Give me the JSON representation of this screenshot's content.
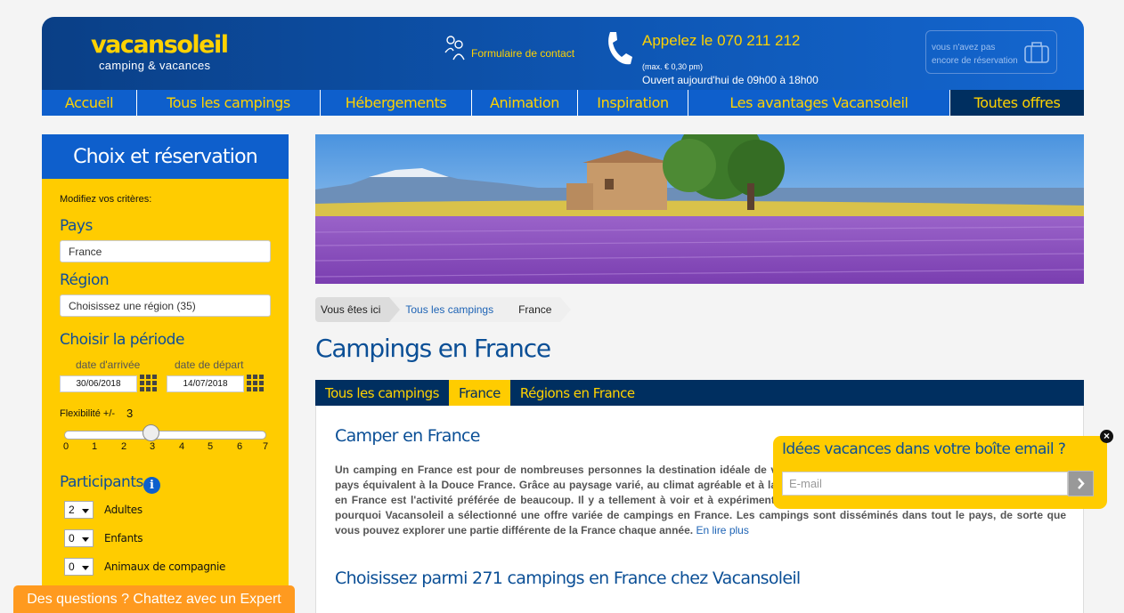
{
  "header": {
    "logo_main": "vacansoleil",
    "logo_sub": "camping & vacances",
    "contact_label": "Formulaire de contact",
    "phone_title": "Appelez le 070 211 212",
    "phone_price": "(max. € 0,30 pm)",
    "phone_hours": "Ouvert aujourd'hui de 09h00 à 18h00",
    "reservation_text": "vous n'avez pas encore de réservation"
  },
  "nav": {
    "items": [
      "Accueil",
      "Tous les campings",
      "Hébergements",
      "Animation",
      "Inspiration",
      "Les avantages Vacansoleil",
      "Toutes offres"
    ]
  },
  "sidebar": {
    "title": "Choix et réservation",
    "modify_label": "Modifiez vos critères:",
    "country_label": "Pays",
    "country_value": "France",
    "region_label": "Région",
    "region_value": "Choisissez une région (35)",
    "period_label": "Choisir la période",
    "arrival_label": "date d'arrivée",
    "arrival_value": "30/06/2018",
    "departure_label": "date de départ",
    "departure_value": "14/07/2018",
    "flex_label": "Flexibilité +/-",
    "flex_value": "3",
    "flex_ticks": [
      "0",
      "1",
      "2",
      "3",
      "4",
      "5",
      "6",
      "7"
    ],
    "participants_label": "Participants",
    "adults_value": "2",
    "adults_label": "Adultes",
    "children_value": "0",
    "children_label": "Enfants",
    "pets_value": "0",
    "pets_label": "Animaux de compagnie"
  },
  "breadcrumb": {
    "here": "Vous êtes ici",
    "link": "Tous les campings",
    "current": "France"
  },
  "main": {
    "title": "Campings en France",
    "tabs": [
      "Tous les campings",
      "France",
      "Régions en France"
    ],
    "section1_title": "Camper en France",
    "section1_text": "Un camping en France est pour de nombreuses personnes la destination idéale de vacances. En plus des différences par rapport à d'autres pays équivalent à la Douce France. Grâce au paysage varié, au climat agréable et à la gastronomie de renommée, séjourner dans un camping en France est l'activité préférée de beaucoup. Il y a tellement à voir et à expérimenter dans cette destination de vacances très prisée. C'est pourquoi Vacansoleil a sélectionné une offre variée de campings en France. Les campings sont disséminés dans tout le pays, de sorte que vous pouvez explorer une partie différente de la France chaque année.",
    "read_more": "En lire plus",
    "section2_title": "Choisissez parmi 271 campings en France chez Vacansoleil"
  },
  "newsletter": {
    "title": "Idées vacances dans votre boîte email ?",
    "placeholder": "E-mail"
  },
  "chat": {
    "label": "Des questions ? Chattez avec un Expert"
  },
  "colors": {
    "brand_blue": "#0e5fcc",
    "dark_blue": "#002f60",
    "yellow": "#ffcc00",
    "orange": "#ff9a1f"
  }
}
